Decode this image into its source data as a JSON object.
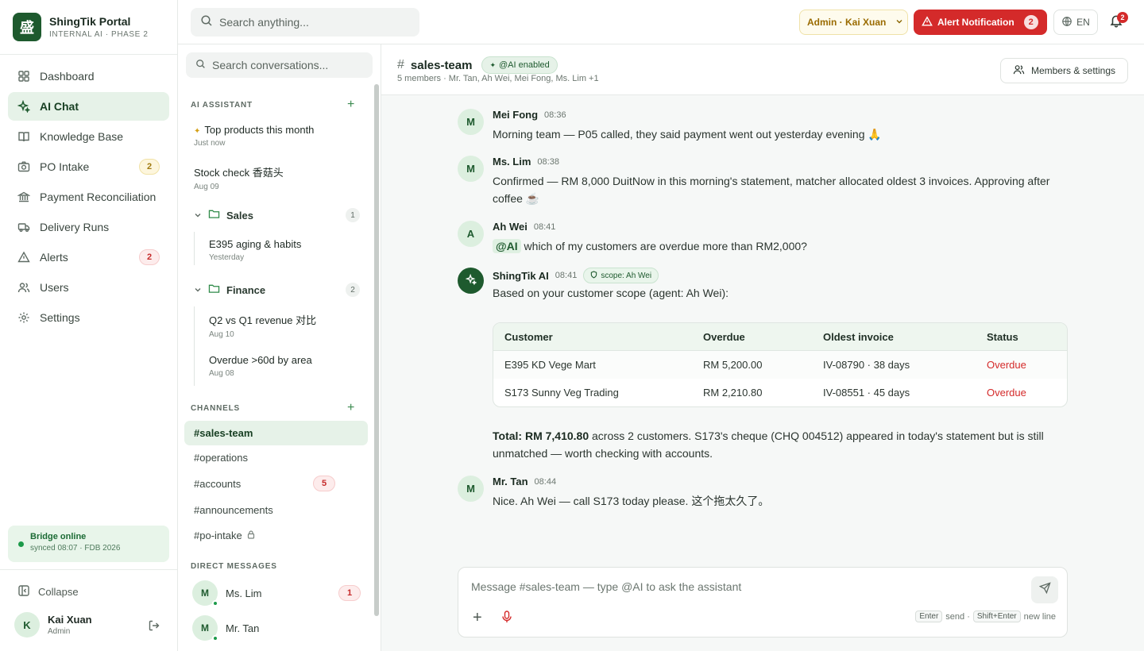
{
  "app": {
    "name": "ShingTik Portal",
    "subtitle": "INTERNAL AI · PHASE 2",
    "logo_char": "盛",
    "accent": "#1e5a2e"
  },
  "nav": {
    "items": [
      {
        "label": "Dashboard",
        "icon": "grid-icon"
      },
      {
        "label": "AI Chat",
        "icon": "sparkles-icon",
        "active": true
      },
      {
        "label": "Knowledge Base",
        "icon": "book-icon"
      },
      {
        "label": "PO Intake",
        "icon": "camera-icon",
        "badge": "2"
      },
      {
        "label": "Payment Reconciliation",
        "icon": "bank-icon"
      },
      {
        "label": "Delivery Runs",
        "icon": "truck-icon"
      },
      {
        "label": "Alerts",
        "icon": "warning-icon",
        "badge": "2"
      },
      {
        "label": "Users",
        "icon": "users-icon"
      },
      {
        "label": "Settings",
        "icon": "gear-icon"
      }
    ]
  },
  "bridge": {
    "title": "Bridge online",
    "sub": "synced 08:07 · FDB 2026"
  },
  "collapse_label": "Collapse",
  "user": {
    "initial": "K",
    "name": "Kai Xuan",
    "role": "Admin"
  },
  "topbar": {
    "search_placeholder": "Search anything...",
    "admin_label": "Admin · Kai Xuan",
    "alert_label": "Alert Notification",
    "alert_count": "2",
    "lang": "EN",
    "bell_count": "2"
  },
  "conv": {
    "search_placeholder": "Search conversations...",
    "ai_header": "AI ASSISTANT",
    "ai_items": [
      {
        "title": "Top products this month",
        "sub": "Just now"
      },
      {
        "title": "Stock check 香菇头",
        "sub": "Aug 09"
      }
    ],
    "folders": [
      {
        "name": "Sales",
        "count": "1",
        "items": [
          {
            "title": "E395 aging & habits",
            "sub": "Yesterday"
          }
        ]
      },
      {
        "name": "Finance",
        "count": "2",
        "items": [
          {
            "title": "Q2 vs Q1 revenue 对比",
            "sub": "Aug 10"
          },
          {
            "title": "Overdue >60d by area",
            "sub": "Aug 08"
          }
        ]
      }
    ],
    "channels_header": "CHANNELS",
    "channels": [
      {
        "name": "#sales-team"
      },
      {
        "name": "#operations"
      },
      {
        "name": "#accounts",
        "badge": "5"
      },
      {
        "name": "#announcements"
      },
      {
        "name": "#po-intake"
      }
    ],
    "dm_header": "DIRECT MESSAGES",
    "dms": [
      {
        "initial": "M",
        "name": "Ms. Lim",
        "badge": "1"
      },
      {
        "initial": "M",
        "name": "Mr. Tan"
      }
    ]
  },
  "channel": {
    "name": "sales-team",
    "ai_pill": "@AI enabled",
    "members": "5 members · Mr. Tan, Ah Wei, Mei Fong, Ms. Lim +1",
    "settings_label": "Members & settings"
  },
  "messages": [
    {
      "initial": "M",
      "name": "Mei Fong",
      "time": "08:36",
      "text": "Morning team — P05 called, they said payment went out yesterday evening 🙏"
    },
    {
      "initial": "M",
      "name": "Ms. Lim",
      "time": "08:38",
      "text": "Confirmed — RM 8,000 DuitNow in this morning's statement, matcher allocated oldest 3 invoices. Approving after coffee ☕"
    },
    {
      "initial": "A",
      "name": "Ah Wei",
      "time": "08:41",
      "mention": "@AI",
      "text": "which of my customers are overdue more than RM2,000?"
    },
    {
      "name": "ShingTik AI",
      "time": "08:41",
      "scope": "scope: Ah Wei",
      "text": "Based on your customer scope (agent: Ah Wei):"
    },
    {
      "initial": "M",
      "name": "Mr. Tan",
      "time": "08:44",
      "text": "Nice. Ah Wei — call S173 today please. 这个拖太久了。"
    }
  ],
  "table": {
    "headers": [
      "Customer",
      "Overdue",
      "Oldest invoice",
      "Status"
    ],
    "rows": [
      [
        "E395 KD Vege Mart",
        "RM 5,200.00",
        "IV-08790 · 38 days",
        "Overdue"
      ],
      [
        "S173 Sunny Veg Trading",
        "RM 2,210.80",
        "IV-08551 · 45 days",
        "Overdue"
      ]
    ]
  },
  "summary": {
    "bold": "Total: RM 7,410.80",
    "rest": " across 2 customers. S173's cheque (CHQ 004512) appeared in today's statement but is still unmatched — worth checking with accounts."
  },
  "composer": {
    "placeholder": "Message #sales-team — type @AI to ask the assistant",
    "key_send": "Enter",
    "send_text": "send ·",
    "key_newline": "Shift+Enter",
    "newline_text": "new line"
  }
}
